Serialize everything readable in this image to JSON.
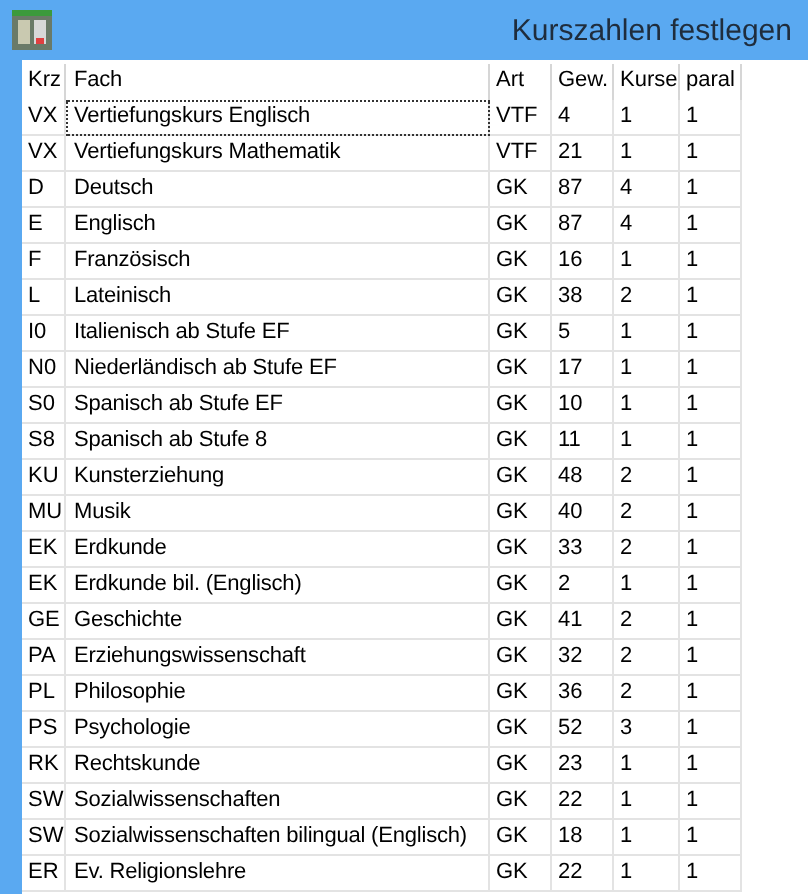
{
  "window": {
    "title": "Kurszahlen festlegen"
  },
  "table": {
    "columns": [
      "Krz",
      "Fach",
      "Art",
      "Gew.",
      "Kurse",
      "paral"
    ],
    "rows": [
      {
        "cells": [
          "VX",
          "Vertiefungskurs Englisch",
          "VTF",
          "4",
          "1",
          "1"
        ],
        "focused": true
      },
      {
        "cells": [
          "VX",
          "Vertiefungskurs Mathematik",
          "VTF",
          "21",
          "1",
          "1"
        ],
        "focused": false
      },
      {
        "cells": [
          "D",
          "Deutsch",
          "GK",
          "87",
          "4",
          "1"
        ],
        "focused": false
      },
      {
        "cells": [
          "E",
          "Englisch",
          "GK",
          "87",
          "4",
          "1"
        ],
        "focused": false
      },
      {
        "cells": [
          "F",
          "Französisch",
          "GK",
          "16",
          "1",
          "1"
        ],
        "focused": false
      },
      {
        "cells": [
          "L",
          "Lateinisch",
          "GK",
          "38",
          "2",
          "1"
        ],
        "focused": false
      },
      {
        "cells": [
          "I0",
          "Italienisch ab Stufe EF",
          "GK",
          "5",
          "1",
          "1"
        ],
        "focused": false
      },
      {
        "cells": [
          "N0",
          "Niederländisch ab Stufe EF",
          "GK",
          "17",
          "1",
          "1"
        ],
        "focused": false
      },
      {
        "cells": [
          "S0",
          "Spanisch ab Stufe EF",
          "GK",
          "10",
          "1",
          "1"
        ],
        "focused": false
      },
      {
        "cells": [
          "S8",
          "Spanisch ab Stufe 8",
          "GK",
          "11",
          "1",
          "1"
        ],
        "focused": false
      },
      {
        "cells": [
          "KU",
          "Kunsterziehung",
          "GK",
          "48",
          "2",
          "1"
        ],
        "focused": false
      },
      {
        "cells": [
          "MU",
          "Musik",
          "GK",
          "40",
          "2",
          "1"
        ],
        "focused": false
      },
      {
        "cells": [
          "EK",
          "Erdkunde",
          "GK",
          "33",
          "2",
          "1"
        ],
        "focused": false
      },
      {
        "cells": [
          "EK",
          "Erdkunde bil. (Englisch)",
          "GK",
          "2",
          "1",
          "1"
        ],
        "focused": false
      },
      {
        "cells": [
          "GE",
          "Geschichte",
          "GK",
          "41",
          "2",
          "1"
        ],
        "focused": false
      },
      {
        "cells": [
          "PA",
          "Erziehungswissenschaft",
          "GK",
          "32",
          "2",
          "1"
        ],
        "focused": false
      },
      {
        "cells": [
          "PL",
          "Philosophie",
          "GK",
          "36",
          "2",
          "1"
        ],
        "focused": false
      },
      {
        "cells": [
          "PS",
          "Psychologie",
          "GK",
          "52",
          "3",
          "1"
        ],
        "focused": false
      },
      {
        "cells": [
          "RK",
          "Rechtskunde",
          "GK",
          "23",
          "1",
          "1"
        ],
        "focused": false
      },
      {
        "cells": [
          "SW",
          "Sozialwissenschaften",
          "GK",
          "22",
          "1",
          "1"
        ],
        "focused": false
      },
      {
        "cells": [
          "SW",
          "Sozialwissenschaften bilingual (Englisch)",
          "GK",
          "18",
          "1",
          "1"
        ],
        "focused": false
      },
      {
        "cells": [
          "ER",
          "Ev. Religionslehre",
          "GK",
          "22",
          "1",
          "1"
        ],
        "focused": false
      }
    ]
  }
}
